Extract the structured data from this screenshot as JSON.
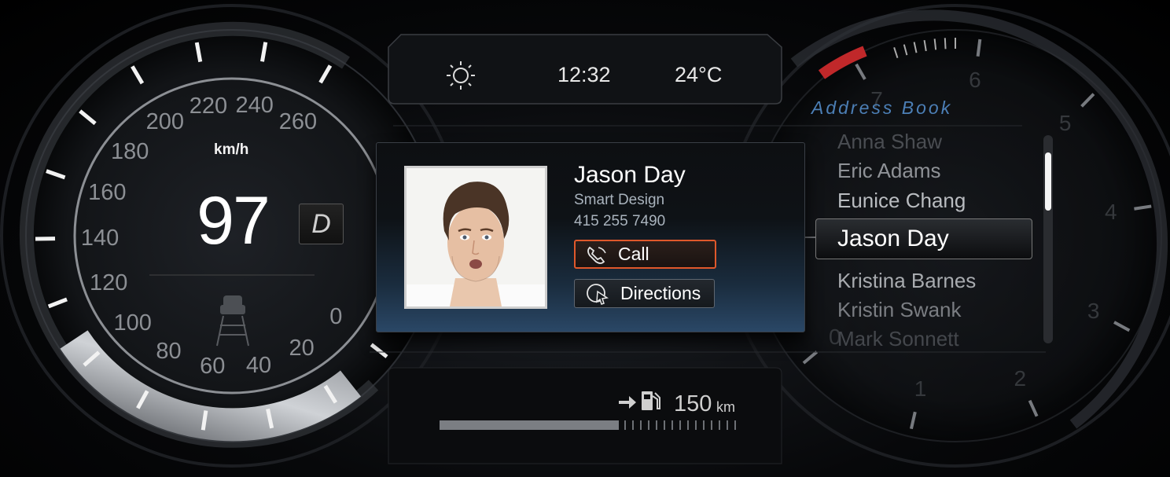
{
  "status": {
    "weather_icon": "sun-icon",
    "time": "12:32",
    "temperature": "24°C"
  },
  "speedometer": {
    "unit": "km/h",
    "speed": "97",
    "gear": "D",
    "tick_labels": [
      "0",
      "20",
      "40",
      "60",
      "80",
      "100",
      "120",
      "140",
      "160",
      "180",
      "200",
      "220",
      "240",
      "260"
    ],
    "lane_assist_icon": "lane-assist-icon"
  },
  "contact": {
    "name": "Jason Day",
    "company": "Smart Design",
    "phone": "415 255 7490",
    "call_label": "Call",
    "directions_label": "Directions"
  },
  "address_book": {
    "title": "Address Book",
    "items": [
      "Anna Shaw",
      "Eric Adams",
      "Eunice Chang",
      "Jason Day",
      "Kristina Barnes",
      "Kristin Swank",
      "Mark Sonnett"
    ],
    "selected": "Jason Day"
  },
  "tachometer": {
    "tick_labels": [
      "0",
      "1",
      "2",
      "3",
      "4",
      "5",
      "6",
      "7"
    ]
  },
  "range": {
    "value": "150",
    "unit": "km",
    "fuel_icon": "fuel-pump-icon",
    "fuel_level": 0.6
  },
  "colors": {
    "accent_orange": "#e0582b",
    "accent_blue": "#4c7fb6",
    "redline": "#c0282a"
  }
}
